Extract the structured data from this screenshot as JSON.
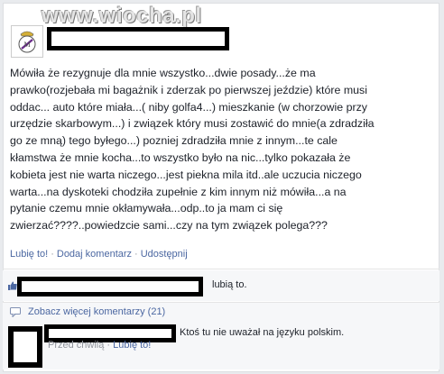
{
  "watermark": "www.wiocha.pl",
  "post": {
    "lines": [
      "Mówiła że rezygnuje dla mnie wszystko...dwie posady...że ma",
      "prawko(rozjebała mi bagażnik i zderzak po pierwszej jeździe) które musi",
      "oddac... auto które miała...( niby golfa4...) mieszkanie (w chorzowie przy",
      "urzędzie skarbowym...) i związek który musi zostawić do mnie(a zdradziła",
      "go ze mną) tego byłego...) pozniej zdradziła mnie z innym...te cale",
      "kłamstwa że mnie kocha...to wszystko było na nic...tylko pokazała że",
      "kobieta jest nie warta niczego...jest piekna mila itd..ale uczucia niczego",
      "warta...na dyskoteki chodziła zupełnie z kim innym niż mówiła...a na",
      "pytanie czemu mnie okłamywała...odp..to ja mam ci się",
      "zwierzać????..powiedzcie sami...czy na tym związek polega???"
    ]
  },
  "actions": {
    "like": "Lubię to!",
    "sep1": "·",
    "comment": "Dodaj komentarz",
    "sep2": "·",
    "share": "Udostępnij"
  },
  "likes": {
    "suffix": "lubią to."
  },
  "more_comments": "Zobacz więcej komentarzy (21)",
  "comment": {
    "text": "Ktoś tu nie uważał na języku polskim.",
    "time": "Przed chwilą",
    "sep": "·",
    "like": "Lubię to!"
  },
  "colors": {
    "link": "#4b67a1",
    "meta": "#90949c",
    "text": "#1d2129"
  },
  "icons": {
    "avatar": "real-madrid-crest-icon",
    "like": "thumbs-up-icon",
    "comment": "comment-bubble-icon"
  }
}
